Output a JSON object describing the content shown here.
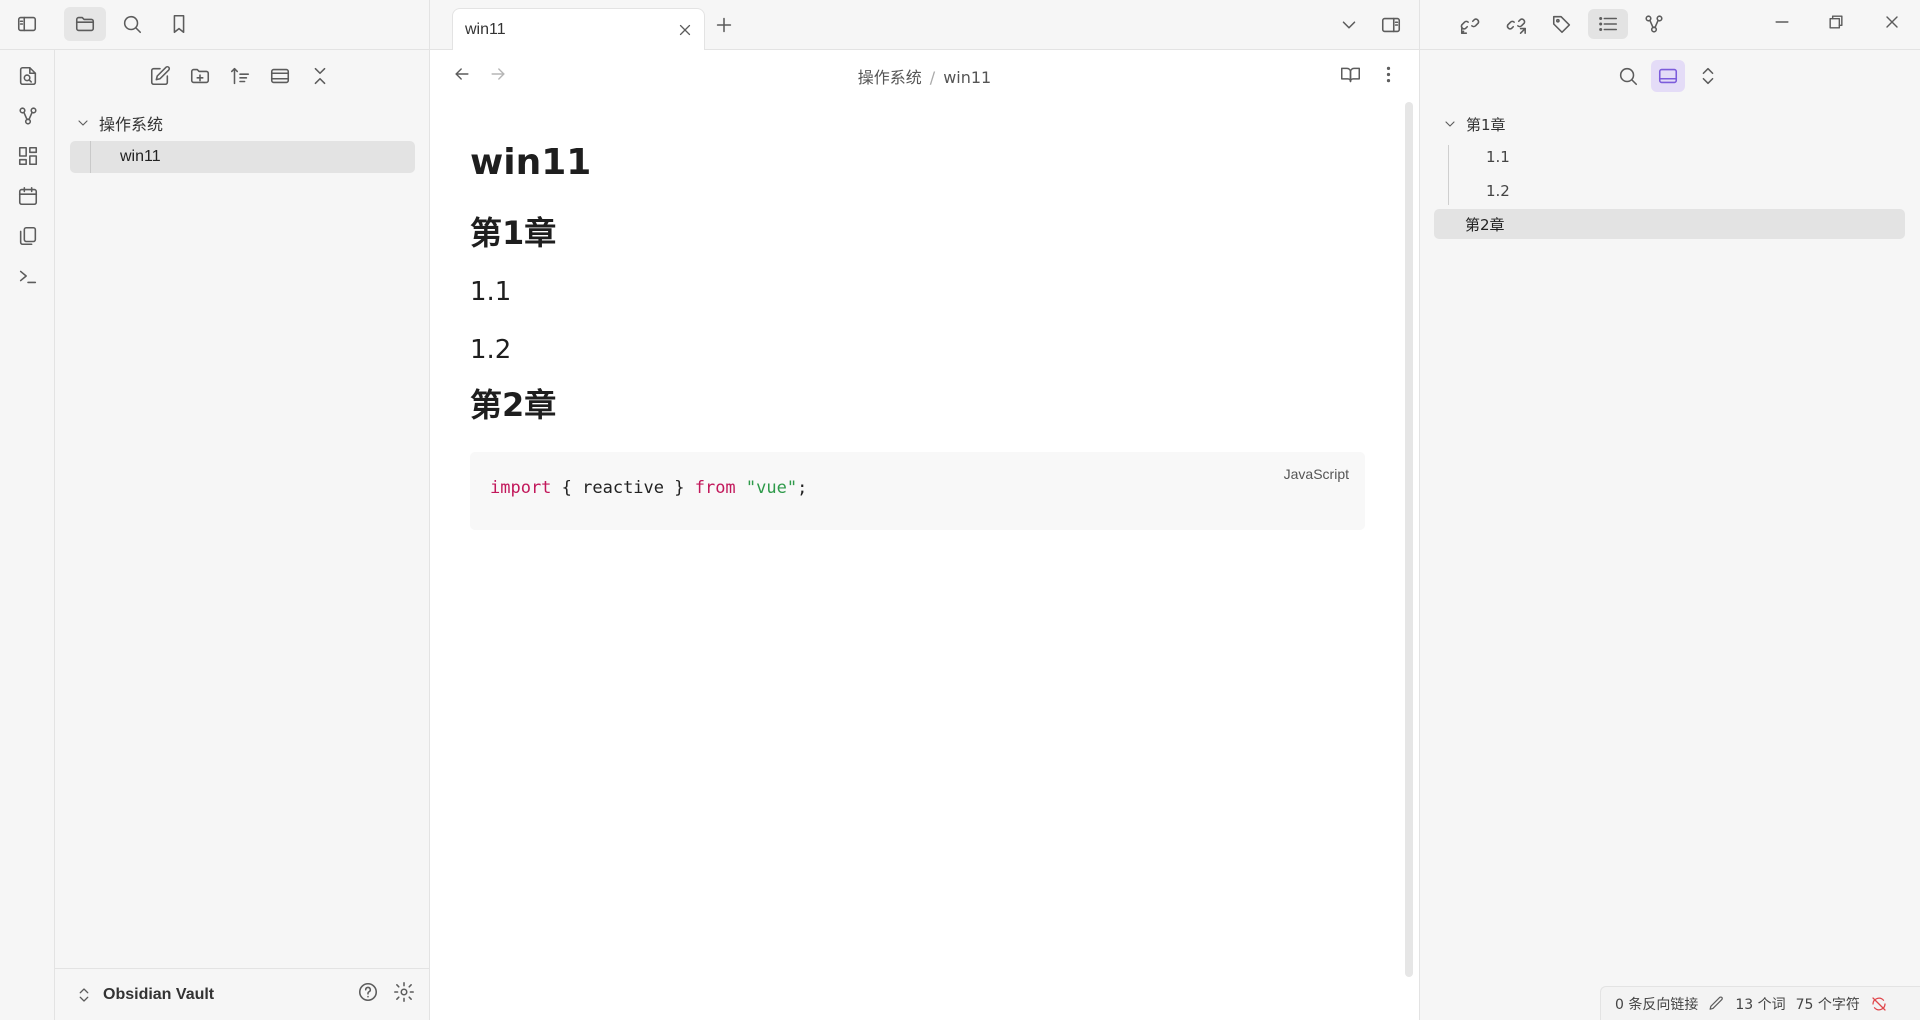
{
  "titlebar": {
    "buttons": [
      "sidebar-toggle-icon",
      "folder-icon",
      "search-icon",
      "bookmark-icon"
    ]
  },
  "ribbon": {
    "items": [
      "quick-switcher-icon",
      "graph-view-icon",
      "canvas-icon",
      "daily-note-icon",
      "templates-icon",
      "command-palette-icon"
    ]
  },
  "explorer": {
    "tools": [
      "new-note-icon",
      "new-folder-icon",
      "sort-icon",
      "collapse-panel-icon",
      "collapse-all-icon"
    ],
    "folder": "操作系统",
    "file": "win11",
    "vault_name": "Obsidian Vault"
  },
  "tabs": [
    {
      "label": "win11"
    }
  ],
  "editor": {
    "breadcrumb_folder": "操作系统",
    "breadcrumb_sep": "/",
    "breadcrumb_file": "win11",
    "title": "win11",
    "h_chapter1": "第1章",
    "h_1_1": "1.1",
    "h_1_2": "1.2",
    "h_chapter2": "第2章",
    "code": {
      "language": "JavaScript",
      "kw_import": "import",
      "mid1": " { reactive } ",
      "kw_from": "from",
      "space": " ",
      "string": "\"vue\"",
      "end": ";"
    }
  },
  "rightpanel": {
    "top_buttons": [
      "backlinks-icon",
      "outgoing-links-icon",
      "tags-icon",
      "outline-icon",
      "local-graph-icon"
    ],
    "outline": {
      "chapter1": "第1章",
      "item_1_1": "1.1",
      "item_1_2": "1.2",
      "chapter2": "第2章"
    }
  },
  "statusbar": {
    "backlinks": "0 条反向链接",
    "words": "13 个词",
    "chars": "75 个字符"
  },
  "colors": {
    "accent": "#7c5cdb",
    "keyword": "#c2185b",
    "string": "#2e9a4a"
  }
}
